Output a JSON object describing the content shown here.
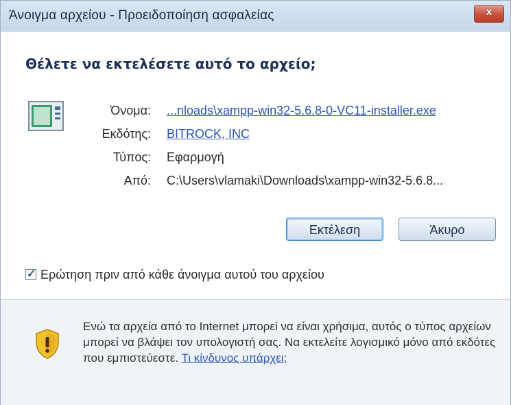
{
  "window": {
    "title": "Άνοιγμα αρχείου - Προειδοποίηση ασφαλείας",
    "close_glyph": "x"
  },
  "question": "Θέλετε να εκτελέσετε αυτό το αρχείο;",
  "fields": {
    "name_label": "Όνομα:",
    "name_value": "...nloads\\xampp-win32-5.6.8-0-VC11-installer.exe",
    "publisher_label": "Εκδότης:",
    "publisher_value": "BITROCK, INC",
    "type_label": "Τύπος:",
    "type_value": "Εφαρμογή",
    "from_label": "Από:",
    "from_value": "C:\\Users\\vlamaki\\Downloads\\xampp-win32-5.6.8..."
  },
  "buttons": {
    "run_label": "Εκτέλεση",
    "cancel_label": "Άκυρο"
  },
  "checkbox": {
    "label": "Ερώτηση πριν από κάθε άνοιγμα αυτού του αρχείου",
    "checked": true
  },
  "warning": {
    "text": "Ενώ τα αρχεία από το Internet μπορεί να είναι χρήσιμα, αυτός ο τύπος αρχείων μπορεί να βλάψει τον υπολογιστή σας. Να εκτελείτε λογισμικό μόνο από εκδότες που εμπιστεύεστε. ",
    "link": "Τι κίνδυνος υπάρχει;"
  },
  "icons": {
    "file": "application-file-icon",
    "warning": "security-shield-warning-icon",
    "close": "close-icon",
    "check": "checkmark-icon"
  },
  "colors": {
    "link": "#2b55b8",
    "question": "#1d2f57",
    "close_button": "#c9503c",
    "shield_yellow": "#f2c12e"
  }
}
